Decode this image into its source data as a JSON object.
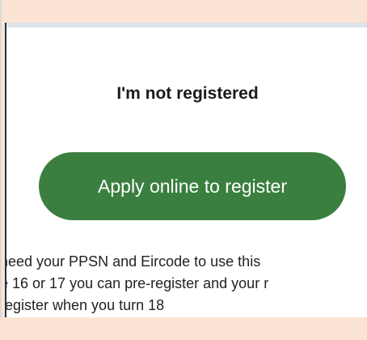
{
  "section": {
    "title": "I'm not registered",
    "apply_button_label": "Apply online to register",
    "body_lines": [
      "need your PPSN and Eircode to use this",
      "e 16 or 17 you can pre-register and your r",
      "register when you turn 18"
    ]
  },
  "colors": {
    "background": "#fbe3d3",
    "button": "#3a7f3f",
    "button_text": "#ffffff",
    "card": "#ffffff"
  }
}
